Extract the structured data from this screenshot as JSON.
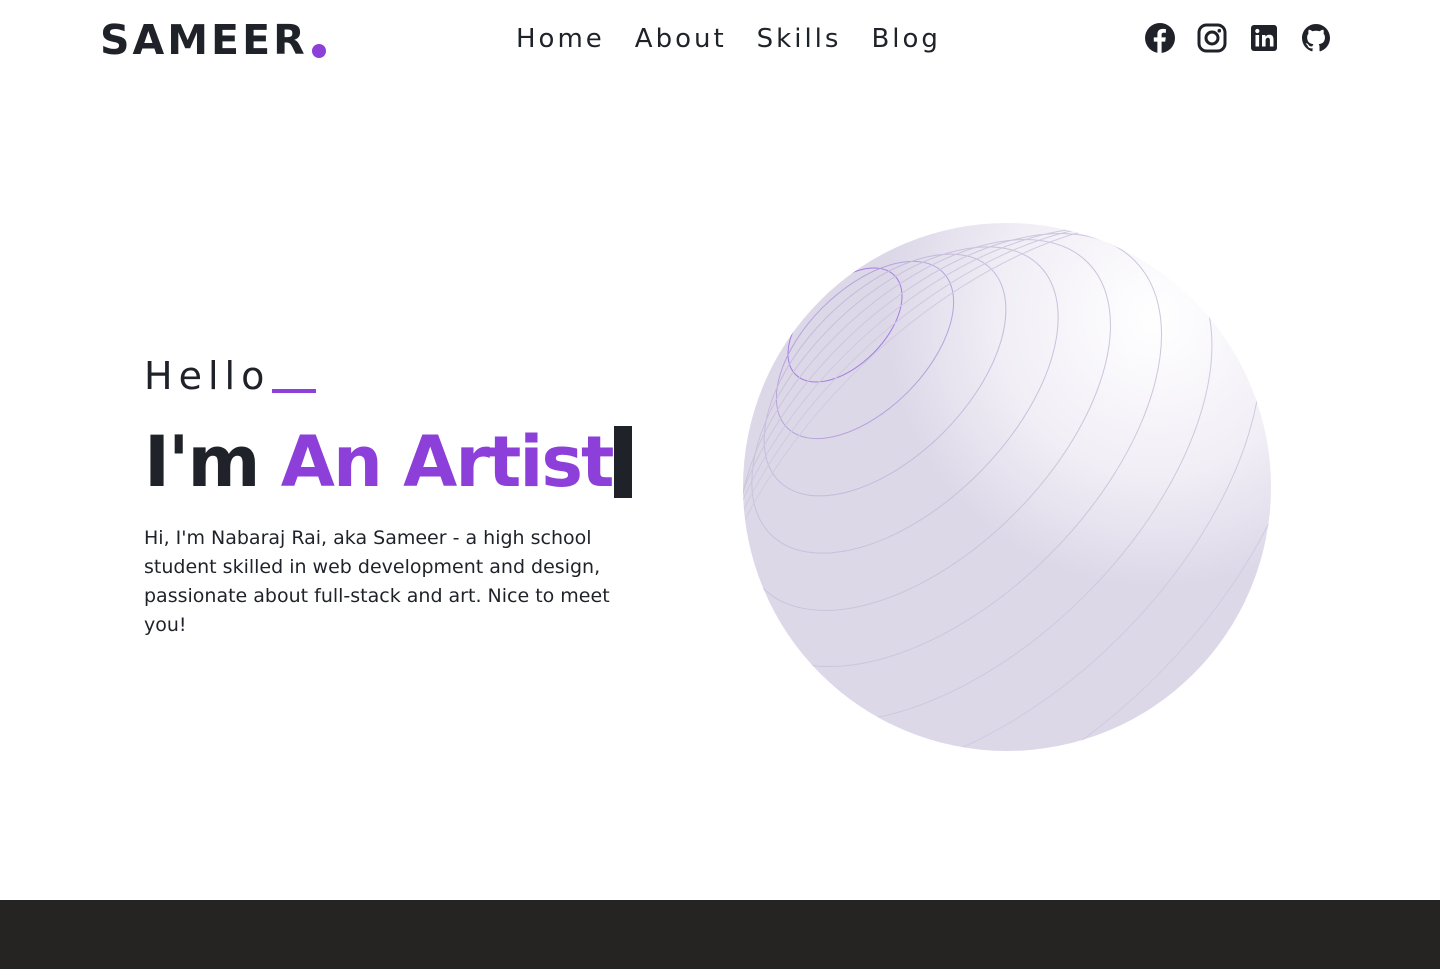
{
  "header": {
    "logo_text": "SAMEER",
    "nav": [
      {
        "label": "Home"
      },
      {
        "label": "About"
      },
      {
        "label": "Skills"
      },
      {
        "label": "Blog"
      }
    ],
    "social_icons": [
      "facebook-icon",
      "instagram-icon",
      "linkedin-icon",
      "github-icon"
    ]
  },
  "hero": {
    "greeting": "Hello",
    "headline_prefix": "I'm ",
    "headline_role": "An Artist",
    "intro": "Hi, I'm Nabaraj Rai, aka Sameer - a high school student skilled in web development and design, passionate about full-stack and art. Nice to meet you!"
  },
  "colors": {
    "accent": "#8d3fd9",
    "text": "#1f2329",
    "sphere": "#ddd8e8",
    "footer": "#252422"
  }
}
